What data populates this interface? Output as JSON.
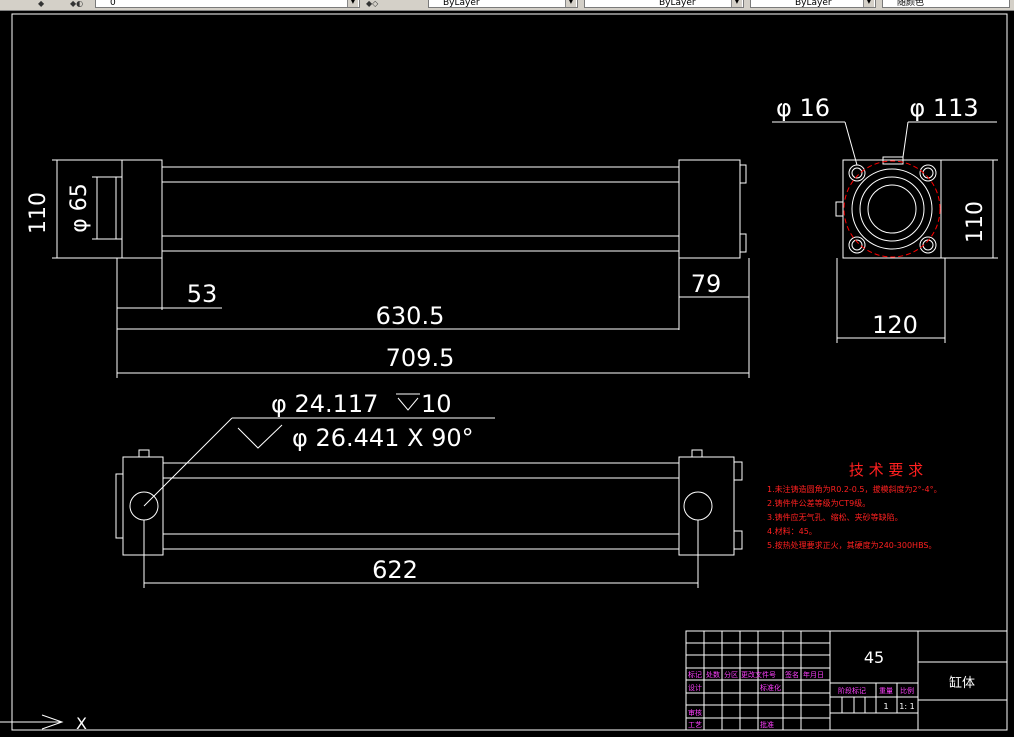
{
  "toolbar": {
    "layer_value": "0",
    "color_value": "ByLayer",
    "linetype_value": "ByLayer",
    "lineweight_value": "ByLayer",
    "plotstyle_value": "随颜色",
    "icons": [
      "layer-manager-icon",
      "layer-state-icon",
      "layer-previous-icon",
      "match-layer-icon"
    ]
  },
  "drawing": {
    "top_view_dims": {
      "height_left": "110",
      "bore_dia": "φ 65",
      "end_left": "53",
      "end_right": "79",
      "length_inner": "630.5",
      "length_total": "709.5"
    },
    "end_view_dims": {
      "hole_dia": "φ 16",
      "circle_dia": "φ 113",
      "height": "110",
      "width": "120"
    },
    "hole_callout": {
      "line1_dia": "φ 24.117",
      "line1_depth": "10",
      "line2": "φ 26.441  X 90°"
    },
    "bottom_view_dims": {
      "hole_spacing": "622"
    }
  },
  "tech_requirements": {
    "title": "技 术 要 求",
    "items": [
      "1.未注铸造圆角为R0.2-0.5，拔模斜度为2°-4°。",
      "2.铸件件公差等级为CT9级。",
      "3.铸件应无气孔、缩松、夹砂等缺陷。",
      "4.材料：45。",
      "5.按热处理要求正火，其硬度为240-300HBS。"
    ]
  },
  "title_block": {
    "material": "45",
    "part_name": "缸体",
    "labels": {
      "mark": "标记",
      "count": "处数",
      "zone": "分区",
      "change_doc": "更改文件号",
      "sign": "签名",
      "date": "年月日",
      "design": "设计",
      "standardize": "标准化",
      "stage_mark": "阶段标记",
      "weight": "重量",
      "scale": "比例",
      "review": "审核",
      "process": "工艺",
      "approve": "批准"
    },
    "qty": "1",
    "scale_value": "1: 1"
  },
  "ucs": {
    "x_label": "X"
  },
  "colors": {
    "background": "#000000",
    "lines": "#ffffff",
    "tech_text": "#ff2020",
    "title_block_labels": "#ff40ff",
    "center_line": "#ff0000"
  }
}
